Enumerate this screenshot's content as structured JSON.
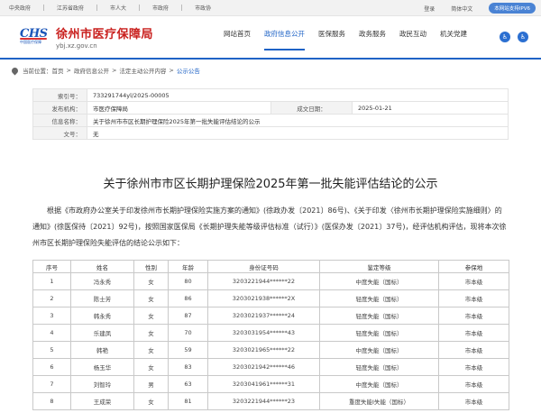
{
  "topbar": {
    "links": [
      "中央政府",
      "江苏省政府",
      "市人大",
      "市政府",
      "市政协"
    ],
    "login": "登录",
    "language": "简体中文",
    "ipv6": "本网站支持IPV6"
  },
  "header": {
    "logo_mark": "CHS",
    "logo_sub": "中国医疗保障",
    "site_name": "徐州市医疗保障局",
    "site_url": "ybj.xz.gov.cn",
    "nav": [
      "网站首页",
      "政府信息公开",
      "医保服务",
      "政务服务",
      "政民互动",
      "机关党建"
    ],
    "active_nav": "政府信息公开",
    "tools": [
      {
        "icon": "elder-mode-icon",
        "glyph": "♿"
      },
      {
        "icon": "accessibility-icon",
        "glyph": "♿"
      }
    ]
  },
  "breadcrumb": {
    "prefix": "当前位置：",
    "items": [
      "首页",
      "政府信息公开",
      "法定主动公开内容",
      "公示公告"
    ]
  },
  "info": {
    "index_label": "索引号：",
    "index_value": "733291744yl/2025-00005",
    "publisher_label": "发布机构：",
    "publisher_value": "市医疗保障局",
    "date_label": "成文日期：",
    "date_value": "2025-01-21",
    "name_label": "信息名称：",
    "name_value": "关于徐州市市区长期护理保险2025年第一批失能评估结论的公示",
    "docno_label": "文号：",
    "docno_value": "无"
  },
  "document": {
    "title": "关于徐州市市区长期护理保险2025年第一批失能评估结论的公示",
    "body": "根据《市政府办公室关于印发徐州市长期护理保险实施方案的通知》(徐政办发〔2021〕86号)、《关于印发〈徐州市长期护理保险实施细则〉的通知》(徐医保待〔2021〕92号)，按照国家医保局《长期护理失能等级评估标准（试行）》(医保办发〔2021〕37号)，经评估机构评估，现将本次徐州市区长期护理保险失能评估的结论公示如下："
  },
  "table": {
    "headers": [
      "序号",
      "姓名",
      "性别",
      "年龄",
      "身份证号码",
      "鉴定等级",
      "参保地"
    ],
    "rows": [
      [
        "1",
        "冯永秀",
        "女",
        "80",
        "3203221944******22",
        "中度失能（国标）",
        "市本级"
      ],
      [
        "2",
        "陈士芳",
        "女",
        "86",
        "3203021938******2X",
        "轻度失能（国标）",
        "市本级"
      ],
      [
        "3",
        "韩永秀",
        "女",
        "87",
        "3203021937******24",
        "轻度失能（国标）",
        "市本级"
      ],
      [
        "4",
        "乐建凤",
        "女",
        "70",
        "3203031954******43",
        "轻度失能（国标）",
        "市本级"
      ],
      [
        "5",
        "韩艳",
        "女",
        "59",
        "3203021965******22",
        "中度失能（国标）",
        "市本级"
      ],
      [
        "6",
        "杨玉华",
        "女",
        "83",
        "3203021942******46",
        "轻度失能（国标）",
        "市本级"
      ],
      [
        "7",
        "刘智玲",
        "男",
        "63",
        "3203041961******31",
        "中度失能（国标）",
        "市本级"
      ],
      [
        "8",
        "王成荣",
        "女",
        "81",
        "3203221944******23",
        "重度失能Ⅰ失能（国标）",
        "市本级"
      ]
    ]
  }
}
